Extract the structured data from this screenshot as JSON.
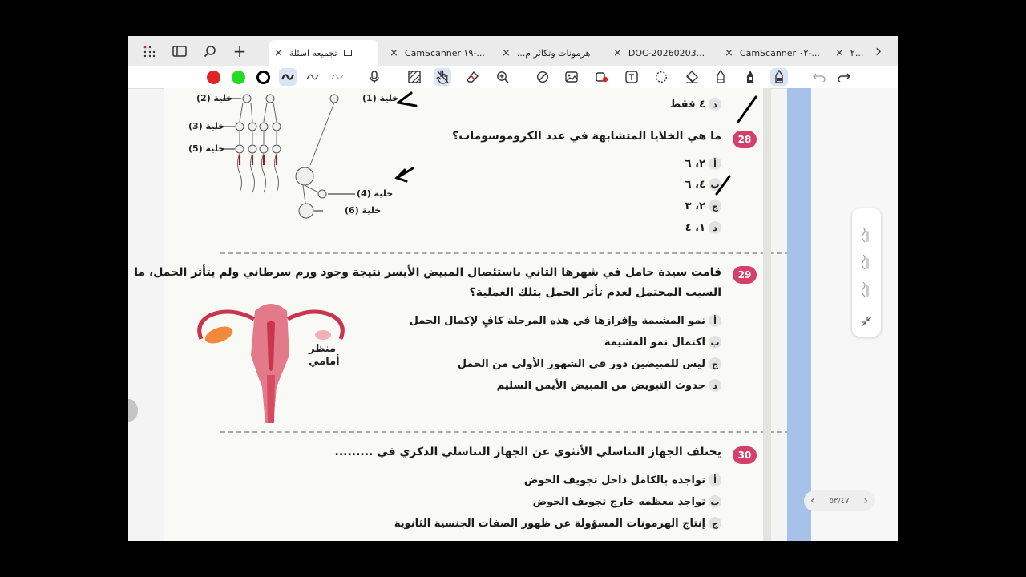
{
  "tabs": [
    {
      "title": "تجميعه اسئلة",
      "active": true
    },
    {
      "title": "CamScanner ١٩-...",
      "active": false
    },
    {
      "title": "هرمونات وتكاثر م...",
      "active": false
    },
    {
      "title": "DOC-20260203...",
      "active": false
    },
    {
      "title": "CamScanner ٠٢-...",
      "active": false
    },
    {
      "title": "٢...",
      "active": false
    }
  ],
  "icons": {
    "apps": "⁞⁞",
    "sidebar": "▤",
    "search": "⌕",
    "add": "+",
    "close": "×",
    "next": "›"
  },
  "colors": {
    "red": "#e02424",
    "green": "#22dd22",
    "black": "#000000",
    "accent": "#d5406b",
    "blue": "#a7c1e8"
  },
  "doc": {
    "diagram_labels": {
      "cell1": "خلية (1)",
      "cell2": "خلية (2)",
      "cell3": "خلية (3)",
      "cell4": "خلية (4)",
      "cell5": "خلية (5)",
      "cell6": "خلية (6)"
    },
    "q27_last_option": "٤ فقط",
    "q28": {
      "num": "28",
      "text": "ما هي الخلايا المتشابهة في عدد الكروموسومات؟",
      "options": [
        {
          "letter": "أ",
          "text": "٢، ٦"
        },
        {
          "letter": "ب",
          "text": "٤، ٦"
        },
        {
          "letter": "ج",
          "text": "٢، ٣"
        },
        {
          "letter": "د",
          "text": "١، ٤"
        }
      ]
    },
    "q29": {
      "num": "29",
      "line1": "قامت سيدة حامل في شهرها الثاني باستئصال المبيض الأيسر نتيجة وجود ورم سرطاني ولم يتأثر الحمل، ما",
      "line2": "السبب المحتمل لعدم تأثر الحمل بتلك العملية؟",
      "figure_label_1": "منظر",
      "figure_label_2": "أمامي",
      "options": [
        {
          "letter": "أ",
          "text": "نمو المشيمة وإفرازها في هذه المرحلة كافٍ لإكمال الحمل"
        },
        {
          "letter": "ب",
          "text": "اكتمال نمو المشيمة"
        },
        {
          "letter": "ج",
          "text": "ليس للمبيضين دور في الشهور الأولى من الحمل"
        },
        {
          "letter": "د",
          "text": "حدوث التبويض من المبيض الأيمن السليم"
        }
      ]
    },
    "q30": {
      "num": "30",
      "text": "يختلف الجهاز التناسلي الأنثوي عن الجهاز التناسلي الذكري في .........",
      "options": [
        {
          "letter": "أ",
          "text": "تواجده بالكامل داخل تجويف الحوض"
        },
        {
          "letter": "ب",
          "text": "تواجد معظمه خارج تجويف الحوض"
        },
        {
          "letter": "ج",
          "text": "إنتاج الهرمونات المسؤولة عن ظهور الصفات الجنسية الثانوية"
        }
      ]
    }
  },
  "pager": {
    "label": "٥٣/٤٧",
    "prev": "‹",
    "next": "›"
  }
}
